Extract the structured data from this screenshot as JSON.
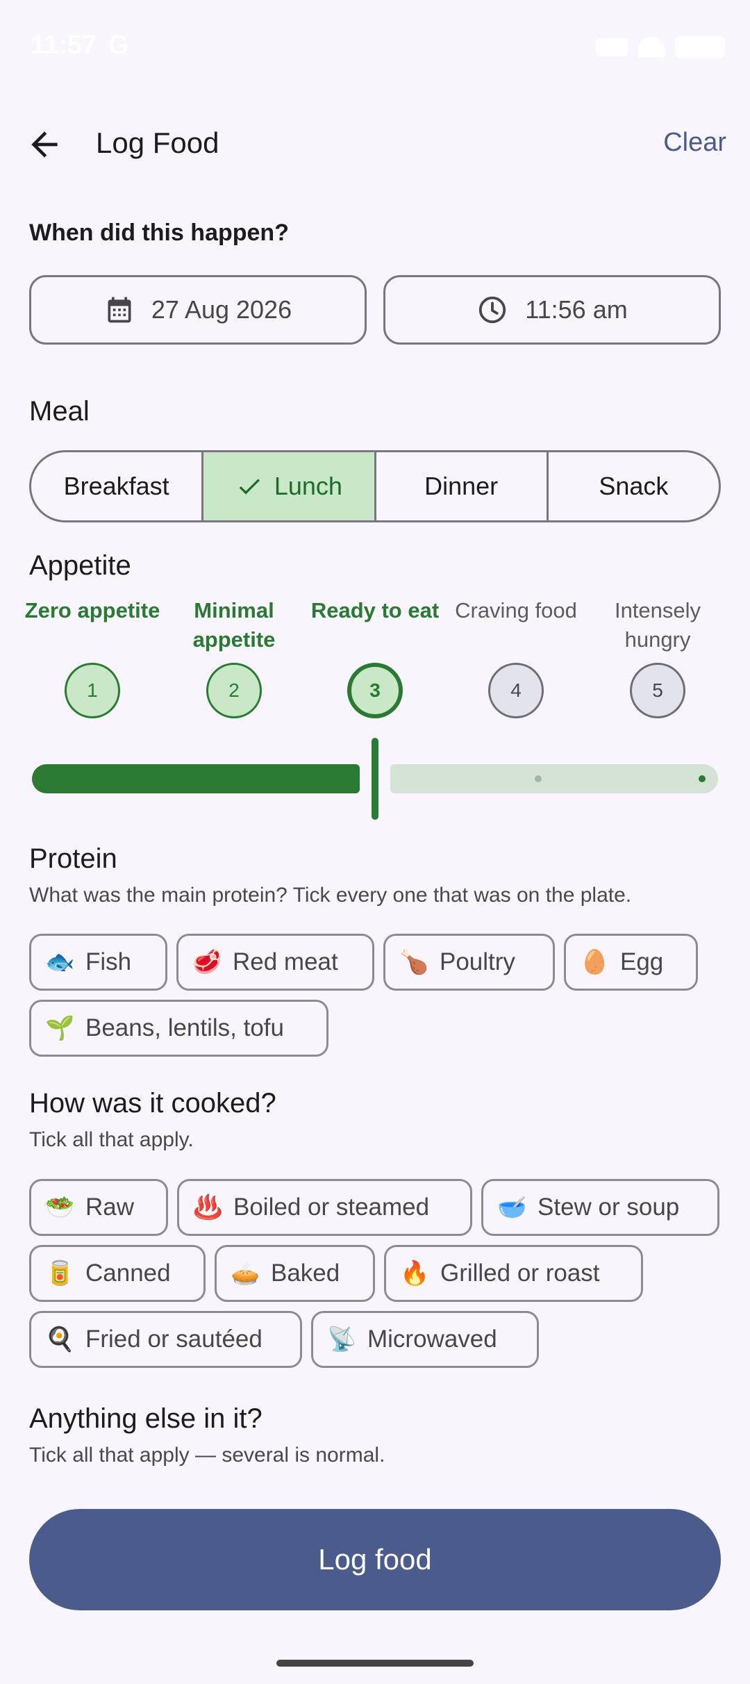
{
  "status": {
    "time": "11:57",
    "g": "G"
  },
  "header": {
    "title": "Log Food",
    "clear_label": "Clear"
  },
  "when": {
    "question": "When did this happen?",
    "date": "27 Aug 2026",
    "time": "11:56 am"
  },
  "meal": {
    "heading": "Meal",
    "options": [
      "Breakfast",
      "Lunch",
      "Dinner",
      "Snack"
    ],
    "selected": "Lunch"
  },
  "appetite": {
    "heading": "Appetite",
    "levels": [
      {
        "label": "Zero appetite",
        "number": "1"
      },
      {
        "label": "Minimal appetite",
        "number": "2"
      },
      {
        "label": "Ready to eat",
        "number": "3"
      },
      {
        "label": "Craving food",
        "number": "4"
      },
      {
        "label": "Intensely hungry",
        "number": "5"
      }
    ],
    "selected_level": 3,
    "colors": {
      "active": "#2b7a34",
      "active_fill": "#c9e8c7",
      "inactive_fill": "#e3e3ec"
    }
  },
  "protein": {
    "heading": "Protein",
    "subtitle": "What was the main protein? Tick every one that was on the plate.",
    "chips": [
      {
        "icon": "fish-icon",
        "emoji": "🐟",
        "label": "Fish"
      },
      {
        "icon": "meat-icon",
        "emoji": "🥩",
        "label": "Red meat"
      },
      {
        "icon": "poultry-icon",
        "emoji": "🍗",
        "label": "Poultry"
      },
      {
        "icon": "egg-icon",
        "emoji": "🥚",
        "label": "Egg"
      },
      {
        "icon": "seedling-icon",
        "emoji": "🌱",
        "label": "Beans, lentils, tofu"
      }
    ]
  },
  "cooked": {
    "heading": "How was it cooked?",
    "subtitle": "Tick all that apply.",
    "chips": [
      {
        "icon": "salad-icon",
        "emoji": "🥗",
        "label": "Raw"
      },
      {
        "icon": "steam-icon",
        "emoji": "♨️",
        "label": "Boiled or steamed"
      },
      {
        "icon": "bowl-icon",
        "emoji": "🥣",
        "label": "Stew or soup"
      },
      {
        "icon": "can-icon",
        "emoji": "🥫",
        "label": "Canned"
      },
      {
        "icon": "pie-icon",
        "emoji": "🥧",
        "label": "Baked"
      },
      {
        "icon": "fire-icon",
        "emoji": "🔥",
        "label": "Grilled or roast"
      },
      {
        "icon": "frying-pan-icon",
        "emoji": "🍳",
        "label": "Fried or sautéed"
      },
      {
        "icon": "microwave-icon",
        "emoji": "📡",
        "label": "Microwaved"
      }
    ]
  },
  "else": {
    "heading": "Anything else in it?",
    "subtitle": "Tick all that apply — several is normal."
  },
  "submit": {
    "label": "Log food",
    "color": "#4a5b8c"
  }
}
